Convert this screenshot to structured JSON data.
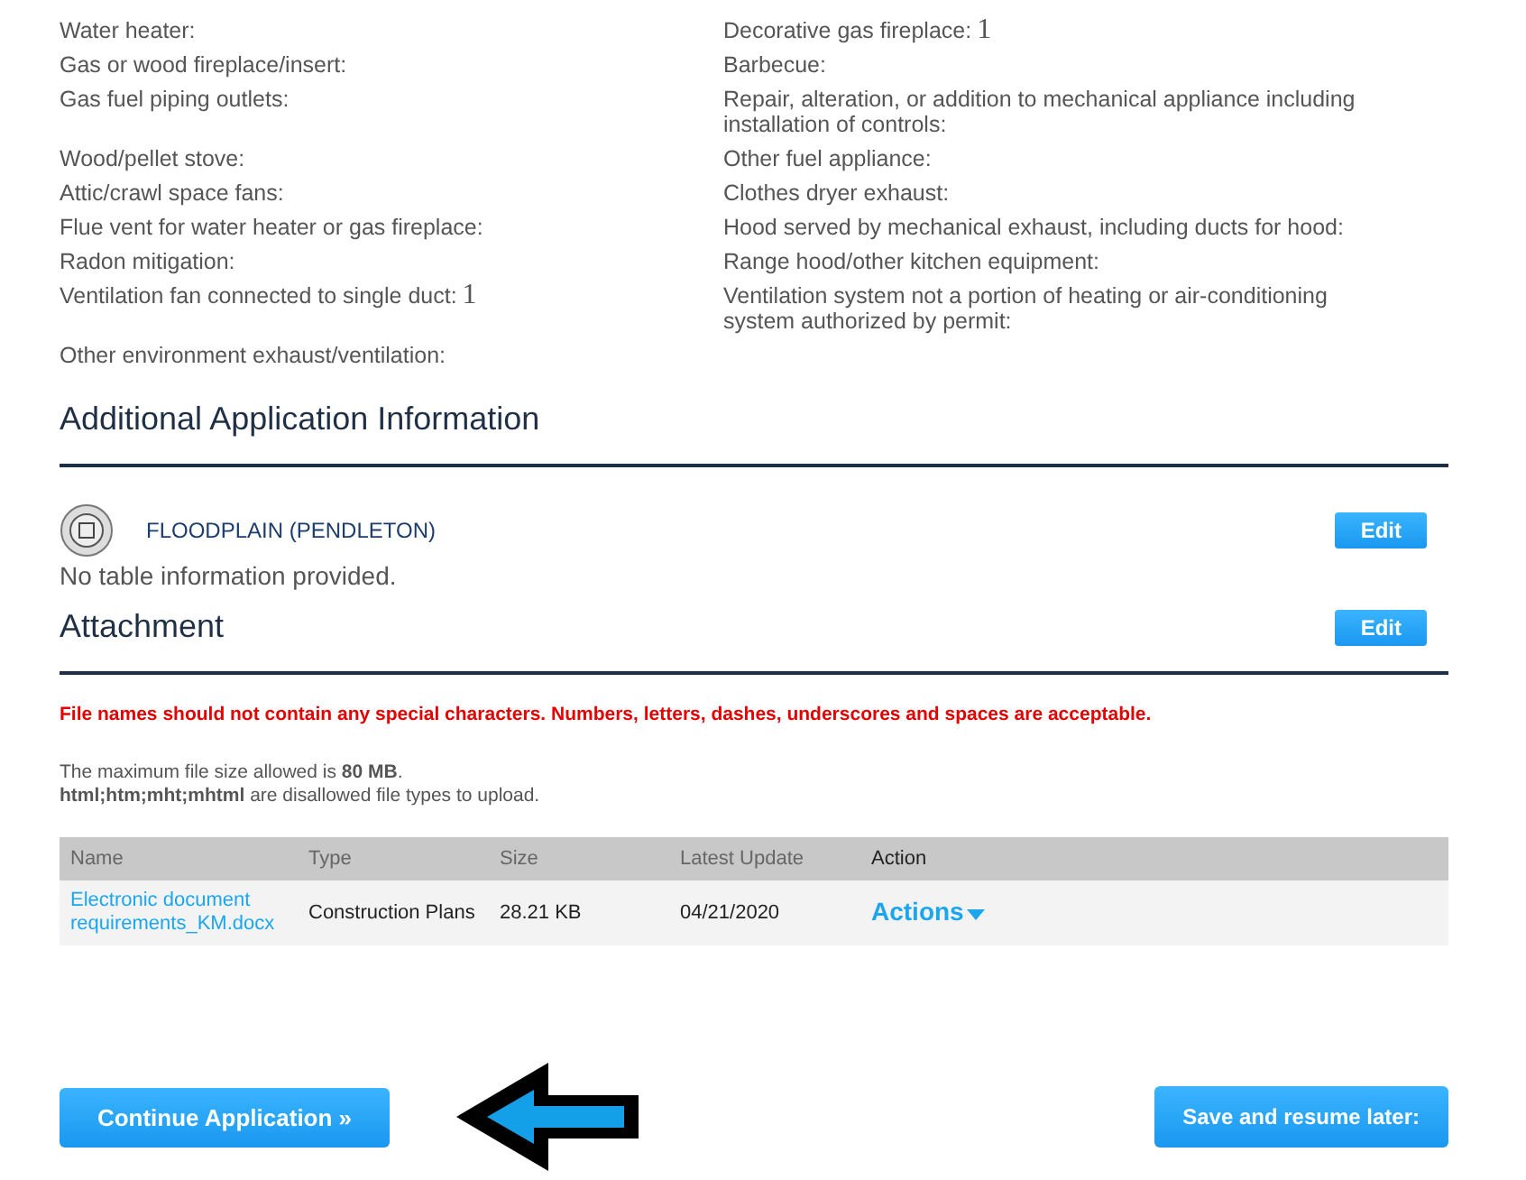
{
  "fields": [
    {
      "label": "Water heater:"
    },
    {
      "label": "Decorative gas fireplace:",
      "value": "1"
    },
    {
      "label": "Gas or wood fireplace/insert:"
    },
    {
      "label": "Barbecue:"
    },
    {
      "label": "Gas fuel piping outlets:"
    },
    {
      "label": "Repair, alteration, or addition to mechanical appliance including installation of controls:"
    },
    {
      "label": "Wood/pellet stove:"
    },
    {
      "label": "Other fuel appliance:"
    },
    {
      "label": "Attic/crawl space fans:"
    },
    {
      "label": "Clothes dryer exhaust:"
    },
    {
      "label": "Flue vent for water heater or gas fireplace:"
    },
    {
      "label": "Hood served by mechanical exhaust, including ducts for hood:"
    },
    {
      "label": "Radon mitigation:"
    },
    {
      "label": "Range hood/other kitchen equipment:"
    },
    {
      "label": "Ventilation fan connected to single duct:",
      "value": "1"
    },
    {
      "label": "Ventilation system not a portion of heating or air-conditioning system authorized by permit:"
    },
    {
      "label": "Other environment exhaust/ventilation:"
    }
  ],
  "additional": {
    "title": "Additional Application Information",
    "agency": "FLOODPLAIN (PENDLETON)",
    "edit": "Edit",
    "empty": "No table information provided."
  },
  "attachment": {
    "title": "Attachment",
    "edit": "Edit",
    "warning": "File names should not contain any special characters. Numbers, letters, dashes, underscores and spaces are acceptable.",
    "note": "The maximum file size allowed is **80 MB**.\n**html;htm;mht;mhtml** are disallowed file types to upload.",
    "table": {
      "columns": [
        "Name",
        "Type",
        "Size",
        "Latest Update",
        "Action"
      ],
      "rows": [
        {
          "name": "Electronic document requirements_KM.docx",
          "type": "Construction Plans",
          "size": "28.21 KB",
          "updated": "04/21/2020",
          "action": "Actions"
        }
      ]
    }
  },
  "buttons": {
    "continue": "Continue Application »",
    "save": "Save and resume later:"
  }
}
